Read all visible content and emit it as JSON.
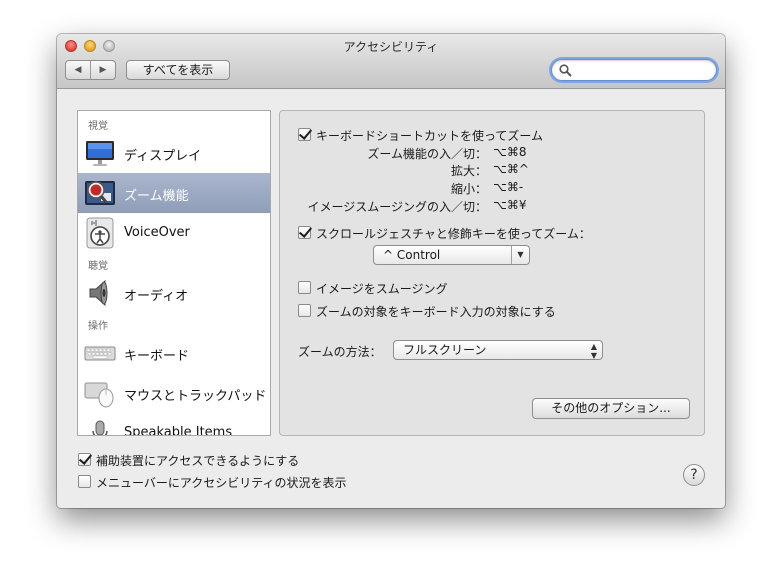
{
  "window": {
    "title": "アクセシビリティ",
    "show_all_label": "すべてを表示",
    "search_placeholder": ""
  },
  "sidebar": {
    "sections": [
      {
        "header": "視覚",
        "items": [
          {
            "label": "ディスプレイ",
            "icon": "display-icon",
            "selected": false
          },
          {
            "label": "ズーム機能",
            "icon": "zoom-icon",
            "selected": true
          },
          {
            "label": "VoiceOver",
            "icon": "voiceover-icon",
            "selected": false
          }
        ]
      },
      {
        "header": "聴覚",
        "items": [
          {
            "label": "オーディオ",
            "icon": "speaker-icon",
            "selected": false
          }
        ]
      },
      {
        "header": "操作",
        "items": [
          {
            "label": "キーボード",
            "icon": "keyboard-icon",
            "selected": false
          },
          {
            "label": "マウスとトラックパッド",
            "icon": "mouse-icon",
            "selected": false
          },
          {
            "label": "Speakable Items",
            "icon": "microphone-icon",
            "selected": false
          }
        ]
      }
    ]
  },
  "zoom": {
    "keyboard_shortcuts_label": "キーボードショートカットを使ってズーム",
    "keyboard_shortcuts_checked": true,
    "shortcuts": [
      {
        "name": "ズーム機能の入／切：",
        "keys": "⌥⌘8"
      },
      {
        "name": "拡大：",
        "keys": "⌥⌘^"
      },
      {
        "name": "縮小：",
        "keys": "⌥⌘-"
      },
      {
        "name": "イメージスムージングの入／切：",
        "keys": "⌥⌘¥"
      }
    ],
    "scroll_gesture_label": "スクロールジェスチャと修飾キーを使ってズーム：",
    "scroll_gesture_checked": true,
    "modifier_value": "^ Control",
    "smoothing_label": "イメージをスムージング",
    "smoothing_checked": false,
    "follow_focus_label": "ズームの対象をキーボード入力の対象にする",
    "follow_focus_checked": false,
    "style_label": "ズームの方法：",
    "style_value": "フルスクリーン",
    "more_options_label": "その他のオプション..."
  },
  "footer": {
    "assistive_label": "補助装置にアクセスできるようにする",
    "assistive_checked": true,
    "menubar_label": "メニューバーにアクセシビリティの状況を表示",
    "menubar_checked": false,
    "help_label": "?"
  },
  "colors": {
    "selection": "#98a5bf",
    "focus_ring": "#7fa6e2"
  }
}
